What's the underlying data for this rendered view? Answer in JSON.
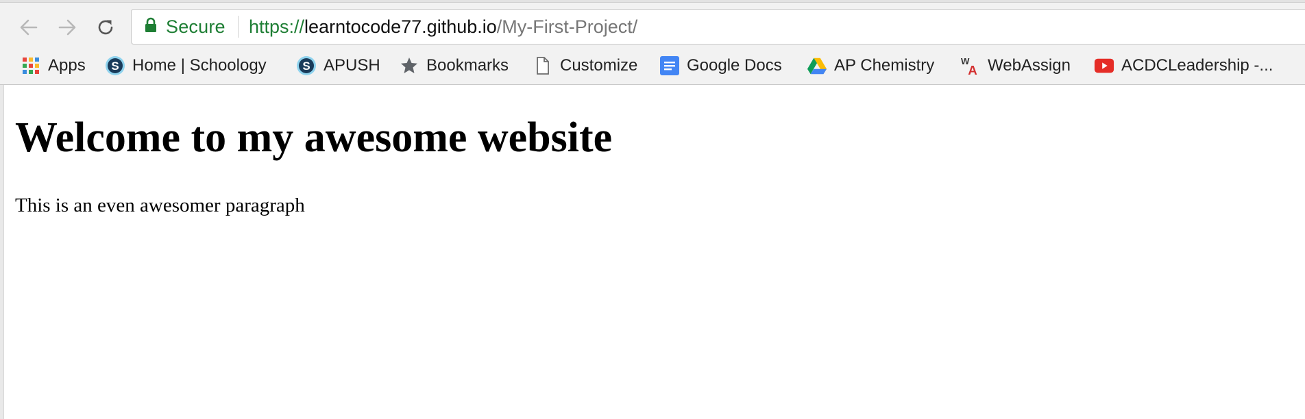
{
  "toolbar": {
    "back_icon": "arrow-left-icon",
    "forward_icon": "arrow-right-icon",
    "reload_icon": "reload-icon"
  },
  "omnibox": {
    "secure_icon": "lock-icon",
    "secure_label": "Secure",
    "url_scheme": "https://",
    "url_host": "learntocode77.github.io",
    "url_path": "/My-First-Project/",
    "secure_color": "#1e7e34"
  },
  "bookmarks": {
    "items": [
      {
        "label": "Apps",
        "icon": "apps-grid-icon"
      },
      {
        "label": "Home | Schoology",
        "icon": "schoology-icon"
      },
      {
        "label": "APUSH",
        "icon": "schoology-icon"
      },
      {
        "label": "Bookmarks",
        "icon": "star-icon"
      },
      {
        "label": "Customize",
        "icon": "page-icon"
      },
      {
        "label": "Google Docs",
        "icon": "google-docs-icon"
      },
      {
        "label": "AP Chemistry",
        "icon": "google-drive-icon"
      },
      {
        "label": "WebAssign",
        "icon": "webassign-icon"
      },
      {
        "label": "ACDCLeadership -...",
        "icon": "youtube-icon"
      }
    ]
  },
  "page": {
    "heading": "Welcome to my awesome website",
    "paragraph": "This is an even awesomer paragraph"
  }
}
